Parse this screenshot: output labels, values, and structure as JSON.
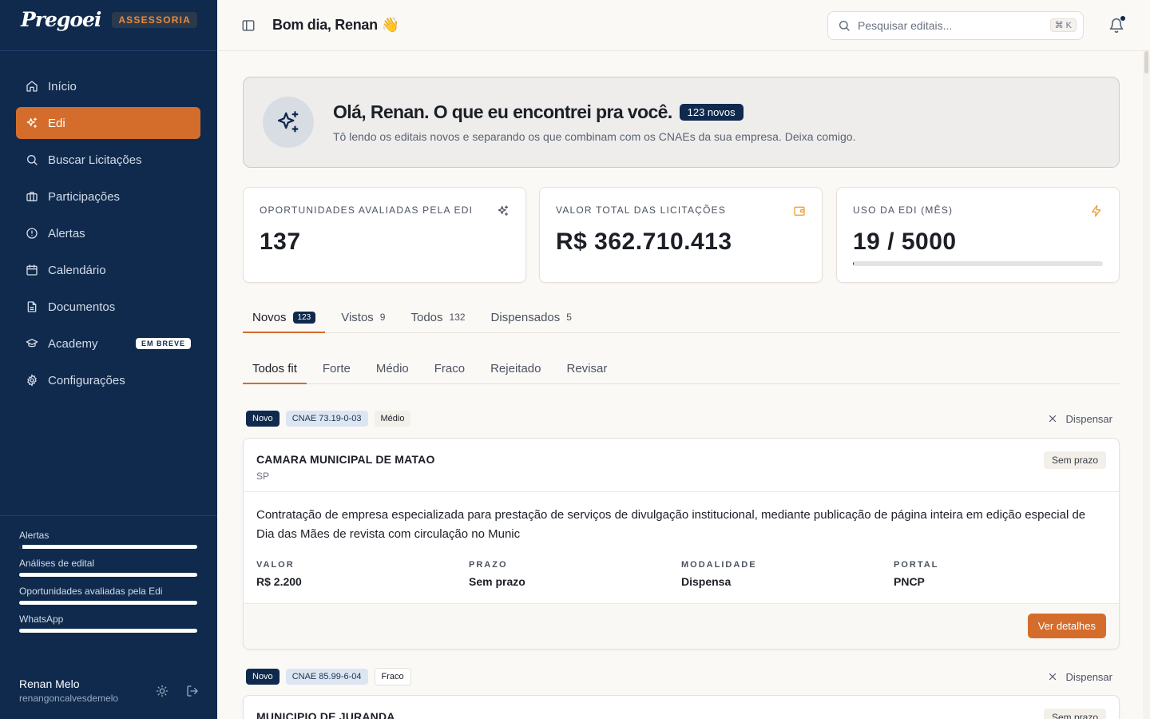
{
  "sidebar": {
    "logo": "Pregoei",
    "badge": "ASSESSORIA",
    "items": [
      {
        "label": "Início"
      },
      {
        "label": "Edi"
      },
      {
        "label": "Buscar Licitações"
      },
      {
        "label": "Participações"
      },
      {
        "label": "Alertas"
      },
      {
        "label": "Calendário"
      },
      {
        "label": "Documentos"
      },
      {
        "label": "Academy",
        "badge": "EM BREVE"
      },
      {
        "label": "Configurações"
      }
    ],
    "usage": [
      {
        "label": "Alertas",
        "fill": 0.02
      },
      {
        "label": "Análises de edital",
        "fill": 0.0
      },
      {
        "label": "Oportunidades avaliadas pela Edi",
        "fill": 0.0
      },
      {
        "label": "WhatsApp",
        "fill": 0.0
      }
    ],
    "user": {
      "name": "Renan Melo",
      "email": "renangoncalvesdemelo"
    }
  },
  "topbar": {
    "greeting": "Bom dia, Renan 👋",
    "search_placeholder": "Pesquisar editais...",
    "search_shortcut": "⌘ K"
  },
  "hero": {
    "title": "Olá, Renan. O que eu encontrei pra você.",
    "badge": "123 novos",
    "subtitle": "Tô lendo os editais novos e separando os que combinam com os CNAEs da sua empresa. Deixa comigo."
  },
  "stats": [
    {
      "label": "OPORTUNIDADES AVALIADAS PELA EDI",
      "value": "137",
      "icon_color": "#4b5260"
    },
    {
      "label": "VALOR TOTAL DAS LICITAÇÕES",
      "value": "R$ 362.710.413",
      "icon_color": "#e8a23c"
    },
    {
      "label": "USO DA EDI (MÊS)",
      "value": "19 / 5000",
      "progress": 0.0038,
      "icon_color": "#e8a23c"
    }
  ],
  "tabs": [
    {
      "label": "Novos",
      "count": "123"
    },
    {
      "label": "Vistos",
      "count": "9"
    },
    {
      "label": "Todos",
      "count": "132"
    },
    {
      "label": "Dispensados",
      "count": "5"
    }
  ],
  "subtabs": [
    {
      "label": "Todos fit"
    },
    {
      "label": "Forte"
    },
    {
      "label": "Médio"
    },
    {
      "label": "Fraco"
    },
    {
      "label": "Rejeitado"
    },
    {
      "label": "Revisar"
    }
  ],
  "dismiss_label": "Dispensar",
  "cards": [
    {
      "status": "Novo",
      "cnae": "CNAE 73.19-0-03",
      "fit": "Médio",
      "org": "CAMARA MUNICIPAL DE MATAO",
      "uf": "SP",
      "deadline": "Sem prazo",
      "description": "Contratação de empresa especializada para prestação de serviços de divulgação institucional, mediante publicação de página inteira em edição especial de Dia das Mães de revista com circulação no Munic",
      "fields": [
        {
          "label": "VALOR",
          "value": "R$ 2.200"
        },
        {
          "label": "PRAZO",
          "value": "Sem prazo"
        },
        {
          "label": "MODALIDADE",
          "value": "Dispensa"
        },
        {
          "label": "PORTAL",
          "value": "PNCP"
        }
      ],
      "button": "Ver detalhes"
    },
    {
      "status": "Novo",
      "cnae": "CNAE 85.99-6-04",
      "fit": "Fraco",
      "org": "MUNICIPIO DE JURANDA",
      "deadline": "Sem prazo"
    }
  ]
}
